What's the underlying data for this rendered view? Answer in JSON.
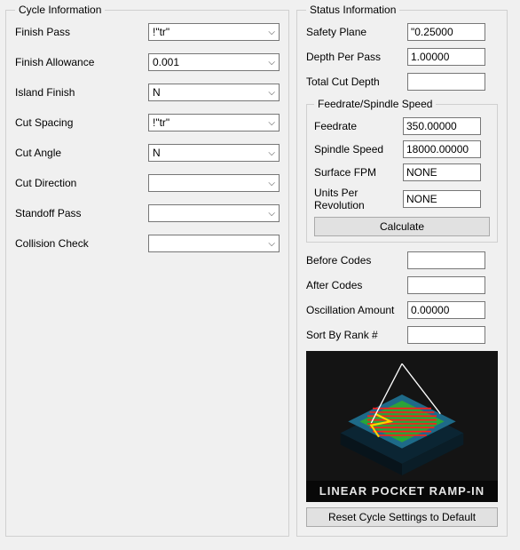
{
  "cycle": {
    "legend": "Cycle Information",
    "fields": {
      "finish_pass": {
        "label": "Finish Pass",
        "value": "!\"tr\""
      },
      "finish_allowance": {
        "label": "Finish Allowance",
        "value": "0.001"
      },
      "island_finish": {
        "label": "Island Finish",
        "value": "N"
      },
      "cut_spacing": {
        "label": "Cut Spacing",
        "value": "!\"tr\""
      },
      "cut_angle": {
        "label": "Cut Angle",
        "value": "N"
      },
      "cut_direction": {
        "label": "Cut Direction",
        "value": ""
      },
      "standoff_pass": {
        "label": "Standoff Pass",
        "value": ""
      },
      "collision_check": {
        "label": "Collision Check",
        "value": ""
      }
    }
  },
  "status": {
    "legend": "Status Information",
    "safety_plane": {
      "label": "Safety Plane",
      "value": "\"0.25000"
    },
    "depth_per_pass": {
      "label": "Depth Per Pass",
      "value": "1.00000"
    },
    "total_cut_depth": {
      "label": "Total Cut Depth",
      "value": ""
    },
    "feedrate_box": {
      "legend": "Feedrate/Spindle Speed",
      "feedrate": {
        "label": "Feedrate",
        "value": "350.00000"
      },
      "spindle_speed": {
        "label": "Spindle Speed",
        "value": "18000.00000"
      },
      "surface_fpm": {
        "label": "Surface FPM",
        "value": "NONE"
      },
      "units_per_rev": {
        "label": "Units Per Revolution",
        "value": "NONE"
      },
      "calculate": "Calculate"
    },
    "before_codes": {
      "label": "Before Codes",
      "value": ""
    },
    "after_codes": {
      "label": "After Codes",
      "value": ""
    },
    "oscillation_amount": {
      "label": "Oscillation Amount",
      "value": "0.00000"
    },
    "sort_by_rank": {
      "label": "Sort By Rank #",
      "value": ""
    },
    "preview_caption": "LINEAR POCKET RAMP-IN",
    "reset": "Reset Cycle Settings to Default"
  }
}
